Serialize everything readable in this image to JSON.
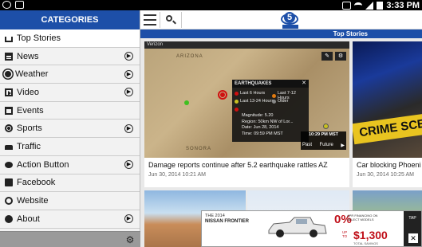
{
  "status_bar": {
    "time": "3:33 PM"
  },
  "drawer": {
    "header": "CATEGORIES",
    "items": [
      {
        "label": "Top Stories",
        "icon": "home-icon",
        "has_arrow": false
      },
      {
        "label": "News",
        "icon": "newspaper-icon",
        "has_arrow": true
      },
      {
        "label": "Weather",
        "icon": "sun-icon",
        "has_arrow": true
      },
      {
        "label": "Video",
        "icon": "video-icon",
        "has_arrow": true
      },
      {
        "label": "Events",
        "icon": "calendar-icon",
        "has_arrow": false
      },
      {
        "label": "Sports",
        "icon": "ball-icon",
        "has_arrow": true
      },
      {
        "label": "Traffic",
        "icon": "car-icon",
        "has_arrow": false
      },
      {
        "label": "Action Button",
        "icon": "chat-icon",
        "has_arrow": true
      },
      {
        "label": "Facebook",
        "icon": "facebook-icon",
        "has_arrow": false
      },
      {
        "label": "Website",
        "icon": "globe-icon",
        "has_arrow": false
      },
      {
        "label": "About",
        "icon": "info-icon",
        "has_arrow": true
      }
    ]
  },
  "appbar": {
    "logo_text": "5",
    "section_title": "Top Stories"
  },
  "stories": [
    {
      "title": "Damage reports continue after 5.2 earthquake rattles AZ",
      "date": "Jun 30, 2014 10:21 AM"
    },
    {
      "title": "Car blocking Phoeni",
      "date": "Jun 30, 2014 10:25 AM"
    }
  ],
  "map": {
    "carrier": "Verizon",
    "state_labels": [
      "ARIZONA",
      "SONORA"
    ],
    "popup": {
      "title": "EARTHQUAKES",
      "legend": [
        "Last 6 Hours",
        "Last 7-12 Hours",
        "Last 13-24 Hours",
        "Older"
      ],
      "magnitude": "Magnitude: 5.20",
      "region": "Region: 50km NW of Lor...",
      "date": "Date: Jun 28, 2014",
      "time": "Time: 09:59 PM MST"
    },
    "timebox": {
      "time": "10:29 PM MST",
      "past": "Past",
      "future": "Future"
    }
  },
  "crime_image": {
    "tape_text": "CRIME SCE"
  },
  "ad": {
    "year_line": "THE 2014",
    "model": "NISSAN FRONTIER",
    "percent": "0%",
    "apr_text": "APR FINANCING ON SELECT MODELS",
    "up_to": "UP TO",
    "amount": "$1,300",
    "total": "TOTAL SAVINGS",
    "tap": "TAP"
  },
  "colors": {
    "brand_blue": "#1d4fa8",
    "ad_red": "#c0101a"
  }
}
